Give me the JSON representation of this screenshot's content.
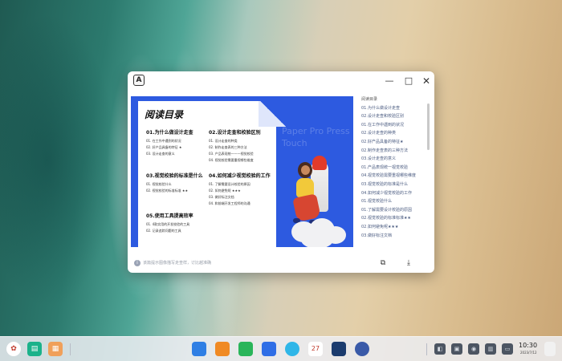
{
  "colors": {
    "preview_bg": "#2d5ae0",
    "toc_text": "#4a5b80",
    "dock_bg": "#eceef2"
  },
  "window": {
    "app_icon_letter": "A",
    "controls": {
      "minimize": "—",
      "maximize": "□",
      "close": "✕"
    }
  },
  "document": {
    "title": "阅读目录",
    "watermark": "Paper Pro Press Touch",
    "sections": [
      {
        "head": "01.为什么做设计走查",
        "items": [
          "01. 在工作中遇到的状况",
          "02. 好产品具备的特征 ★",
          "03. 设计走查的意义"
        ]
      },
      {
        "head": "02.设计走查和校验区别",
        "items": [
          "01. 设计走查的种类",
          "02. 制作走查表的三种方法",
          "03. 产品表现统一——视觉校验",
          "04. 视觉校验需要重视哪些维度"
        ]
      },
      {
        "head": "03.视觉校验的标准是什么",
        "items": [
          "01. 视觉校验什么",
          "02. 视觉校验的标准标准 ★★"
        ]
      },
      {
        "head": "04.如何减少视觉校验的工作",
        "items": [
          "01. 了解需要设计校验的原因",
          "02. 如何避免呢 ★★★",
          "03. 做好标注文档",
          "04. 和前端开发工程师的沟通"
        ]
      },
      {
        "head": "05.使用工具提高效率",
        "items": [
          "01. 4款实用的开发校验的工具",
          "02. 记录追踪问题的工具"
        ]
      }
    ]
  },
  "status_bar": {
    "info_icon": "i",
    "text": "该篇提示图像描写走查样，订比越准确",
    "copy_icon": "⧉",
    "download_icon": "⤓"
  },
  "toc": {
    "items": [
      "阅读目录",
      "01.为什么做设计走查",
      "02.设计走查和校验区别",
      "01.在工作中遇到的状况",
      "02.设计走查的种类",
      "02.好产品具备的特征★",
      "02.制作走查表的三种方法",
      "03.设计走查的意义",
      "01.产品表现统一视觉校验",
      "04.视觉校验需要重视哪些维度",
      "03.视觉校验的标准是什么",
      "04.如何减少视觉校验的工作",
      "01.视觉校验什么",
      "01.了解需要设计校验的原因",
      "02.视觉校验的标准标准★★",
      "02.如何避免呢★★★",
      "03.做好标注文档"
    ]
  },
  "dock": {
    "launcher_icon": "✿",
    "files_icon": "▤",
    "store_icon": "▦",
    "calendar_day": "27",
    "tray_icons": [
      "◧",
      "▣",
      "◉",
      "▥",
      "▭"
    ],
    "time": "10:30",
    "date": "2023/7/12"
  }
}
